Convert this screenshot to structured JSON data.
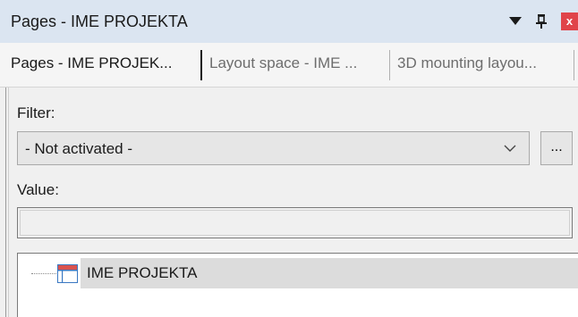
{
  "window": {
    "title": "Pages - IME PROJEKTA",
    "close_glyph": "x"
  },
  "tabs": [
    {
      "label": "Pages - IME PROJEK...",
      "active": true
    },
    {
      "label": "Layout space - IME ...",
      "active": false
    },
    {
      "label": "3D mounting layou...",
      "active": false
    }
  ],
  "filter": {
    "label": "Filter:",
    "selected": "- Not activated -",
    "more_label": "..."
  },
  "value": {
    "label": "Value:",
    "text": ""
  },
  "tree": {
    "items": [
      {
        "label": "IME PROJEKTA",
        "icon": "page-icon",
        "selected": true
      }
    ]
  },
  "colors": {
    "titlebar": "#dbe5f1",
    "close_button": "#e0444a",
    "selection": "#dcdcdc",
    "icon_accent": "#d9534f"
  }
}
